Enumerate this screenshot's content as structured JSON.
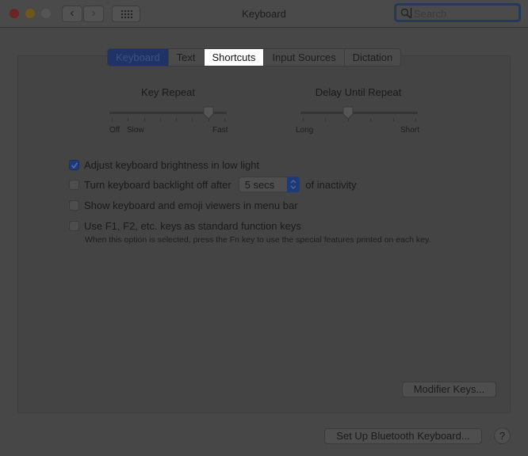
{
  "window": {
    "title": "Keyboard",
    "search_placeholder": "Search",
    "search_value": ""
  },
  "tabs": [
    {
      "label": "Keyboard",
      "state": "selected"
    },
    {
      "label": "Text",
      "state": "normal"
    },
    {
      "label": "Shortcuts",
      "state": "highlighted"
    },
    {
      "label": "Input Sources",
      "state": "normal"
    },
    {
      "label": "Dictation",
      "state": "normal"
    }
  ],
  "sliders": {
    "key_repeat": {
      "label": "Key Repeat",
      "left_labels": [
        "Off",
        "Slow"
      ],
      "right_label": "Fast",
      "tick_count": 8,
      "value_index": 6
    },
    "delay_until_repeat": {
      "label": "Delay Until Repeat",
      "left_label": "Long",
      "right_label": "Short",
      "tick_count": 6,
      "value_index": 2
    }
  },
  "options": [
    {
      "label": "Adjust keyboard brightness in low light",
      "checked": true
    },
    {
      "label": "Turn keyboard backlight off after",
      "checked": false,
      "popup_value": "5 secs",
      "suffix": "of inactivity"
    },
    {
      "label": "Show keyboard and emoji viewers in menu bar",
      "checked": false
    },
    {
      "label": "Use F1, F2, etc. keys as standard function keys",
      "checked": false,
      "note": "When this option is selected, press the Fn key to use the special features printed on each key."
    }
  ],
  "buttons": {
    "modifier_keys": "Modifier Keys...",
    "bluetooth": "Set Up Bluetooth Keyboard...",
    "help": "?"
  },
  "colors": {
    "accent": "#1f3a78",
    "background": "#474747"
  }
}
